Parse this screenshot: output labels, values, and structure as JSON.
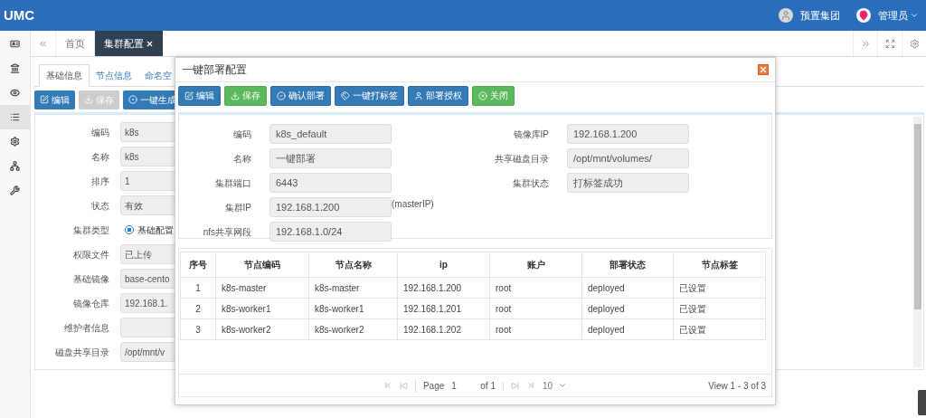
{
  "header": {
    "logo": "UMC",
    "org": "预置集团",
    "user": "管理员"
  },
  "sidebar": {
    "items": [
      {
        "selected": false
      },
      {
        "selected": false
      },
      {
        "selected": false
      },
      {
        "selected": true
      },
      {
        "selected": false
      },
      {
        "selected": false
      },
      {
        "selected": false
      }
    ]
  },
  "page_tabs": [
    {
      "label": "首页",
      "selected": false,
      "closable": false
    },
    {
      "label": "集群配置",
      "selected": true,
      "closable": true
    }
  ],
  "sub_tabs": [
    {
      "label": "基础信息",
      "selected": true
    },
    {
      "label": "节点信息",
      "selected": false
    },
    {
      "label": "命名空",
      "selected": false
    }
  ],
  "toolbar": [
    {
      "label": "编辑",
      "disabled": false
    },
    {
      "label": "保存",
      "disabled": true
    },
    {
      "label": "一键生成",
      "disabled": false
    }
  ],
  "form": [
    {
      "label": "编码",
      "kind": "input",
      "value": "k8s"
    },
    {
      "label": "名称",
      "kind": "input",
      "value": "k8s"
    },
    {
      "label": "排序",
      "kind": "input",
      "value": "1"
    },
    {
      "label": "状态",
      "kind": "input",
      "value": "有效"
    },
    {
      "label": "集群类型",
      "kind": "radio",
      "value": "基础配置",
      "checked": true
    },
    {
      "label": "权限文件",
      "kind": "input",
      "value": "已上传"
    },
    {
      "label": "基础镜像",
      "kind": "input",
      "value": "base-cento"
    },
    {
      "label": "镜像仓库",
      "kind": "input",
      "value": "192.168.1."
    },
    {
      "label": "维护者信息",
      "kind": "input"
    },
    {
      "label": "磁盘共享目录",
      "kind": "input",
      "value": "/opt/mnt/v"
    }
  ],
  "dialog": {
    "title": "一键部署配置",
    "buttons": [
      {
        "label": "编辑",
        "kind": "primary"
      },
      {
        "label": "保存",
        "kind": "success"
      },
      {
        "label": "确认部署",
        "kind": "primary"
      },
      {
        "label": "一键打标签",
        "kind": "primary"
      },
      {
        "label": "部署授权",
        "kind": "primary"
      },
      {
        "label": "关闭",
        "kind": "success"
      }
    ],
    "fields_left": [
      {
        "label": "编码",
        "value": "k8s_default"
      },
      {
        "label": "名称",
        "value": "一键部署"
      },
      {
        "label": "集群端口",
        "value": "6443"
      },
      {
        "label": "集群IP",
        "value": "192.168.1.200",
        "note": "(masterIP)"
      },
      {
        "label": "nfs共享网段",
        "value": "192.168.1.0/24"
      }
    ],
    "fields_right": [
      {
        "label": "镜像库IP",
        "value": "192.168.1.200"
      },
      {
        "label": "共享磁盘目录",
        "value": "/opt/mnt/volumes/"
      },
      {
        "label": "集群状态",
        "value": "打标签成功"
      }
    ],
    "table": {
      "columns": [
        "序号",
        "节点编码",
        "节点名称",
        "ip",
        "账户",
        "部署状态",
        "节点标签"
      ],
      "rows": [
        [
          "1",
          "k8s-master",
          "k8s-master",
          "192.168.1.200",
          "root",
          "deployed",
          "已设置"
        ],
        [
          "2",
          "k8s-worker1",
          "k8s-worker1",
          "192.168.1.201",
          "root",
          "deployed",
          "已设置"
        ],
        [
          "3",
          "k8s-worker2",
          "k8s-worker2",
          "192.168.1.202",
          "root",
          "deployed",
          "已设置"
        ]
      ]
    },
    "pager": {
      "page_label": "Page",
      "page": "1",
      "of": "of 1",
      "page_size": "10",
      "summary": "View 1 - 3 of 3"
    }
  }
}
